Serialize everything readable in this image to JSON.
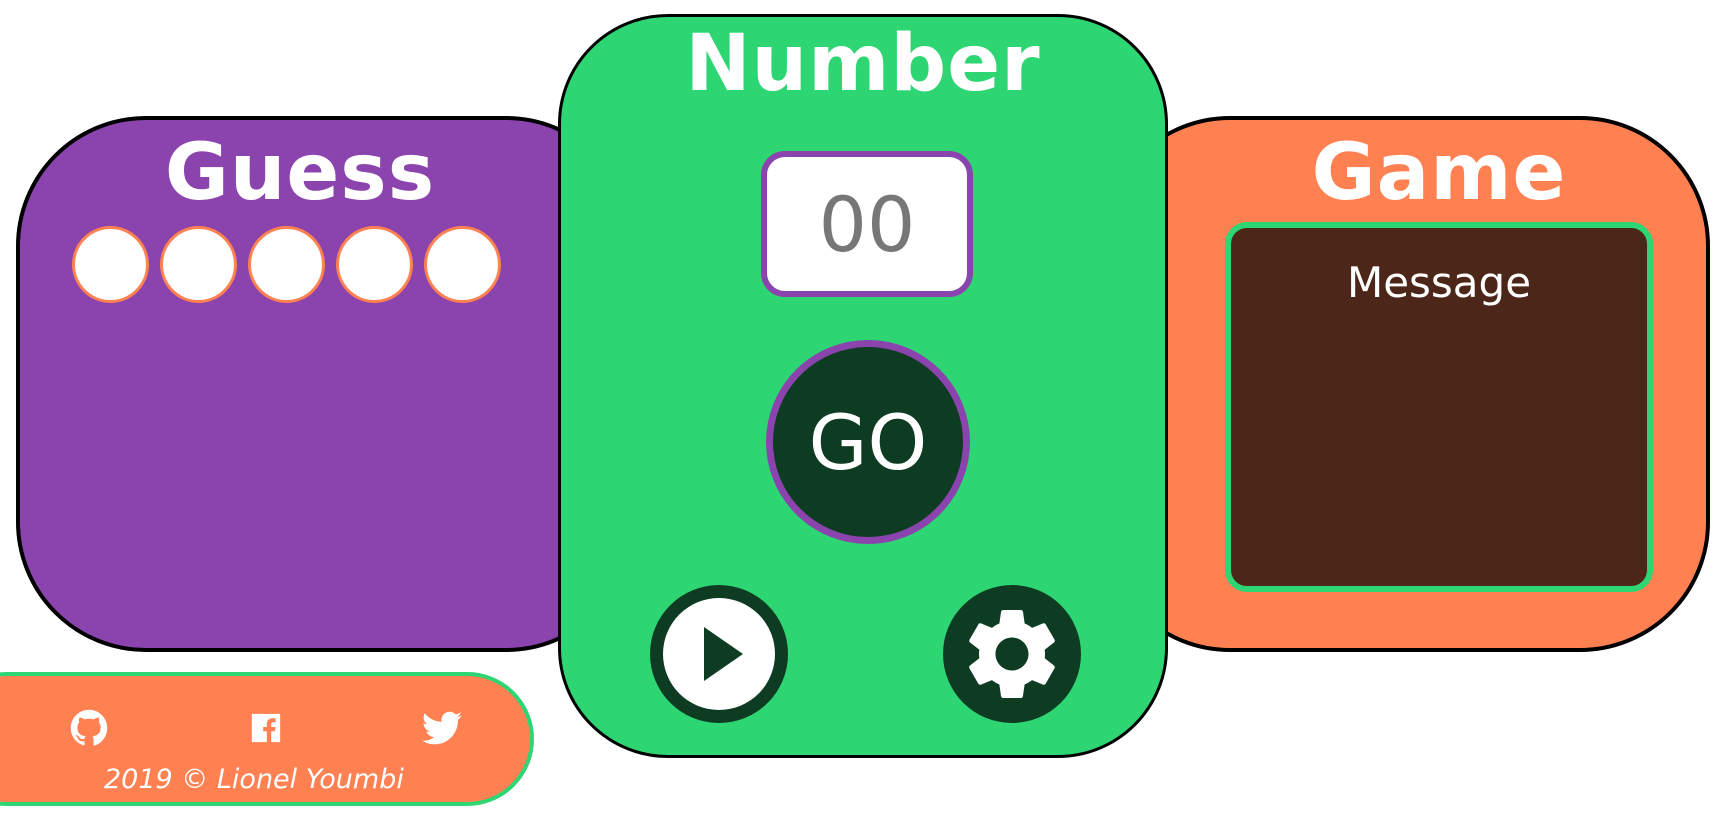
{
  "panels": {
    "left_title": "Guess",
    "center_title": "Number",
    "right_title": "Game"
  },
  "lives": {
    "count": 5
  },
  "number_input": {
    "value": "00"
  },
  "go_button": {
    "label": "GO"
  },
  "message": {
    "text": "Message"
  },
  "controls": {
    "play": {
      "icon": "play-icon"
    },
    "settings": {
      "icon": "gear-icon"
    }
  },
  "footer": {
    "social": [
      "github-icon",
      "facebook-icon",
      "twitter-icon"
    ],
    "copyright": "2019 © Lionel Youmbi"
  },
  "colors": {
    "purple": "#8b44ad",
    "green": "#2ed573",
    "orange": "#ff8152",
    "dark_green": "#0e3c22",
    "message_bg": "#4c2618"
  }
}
